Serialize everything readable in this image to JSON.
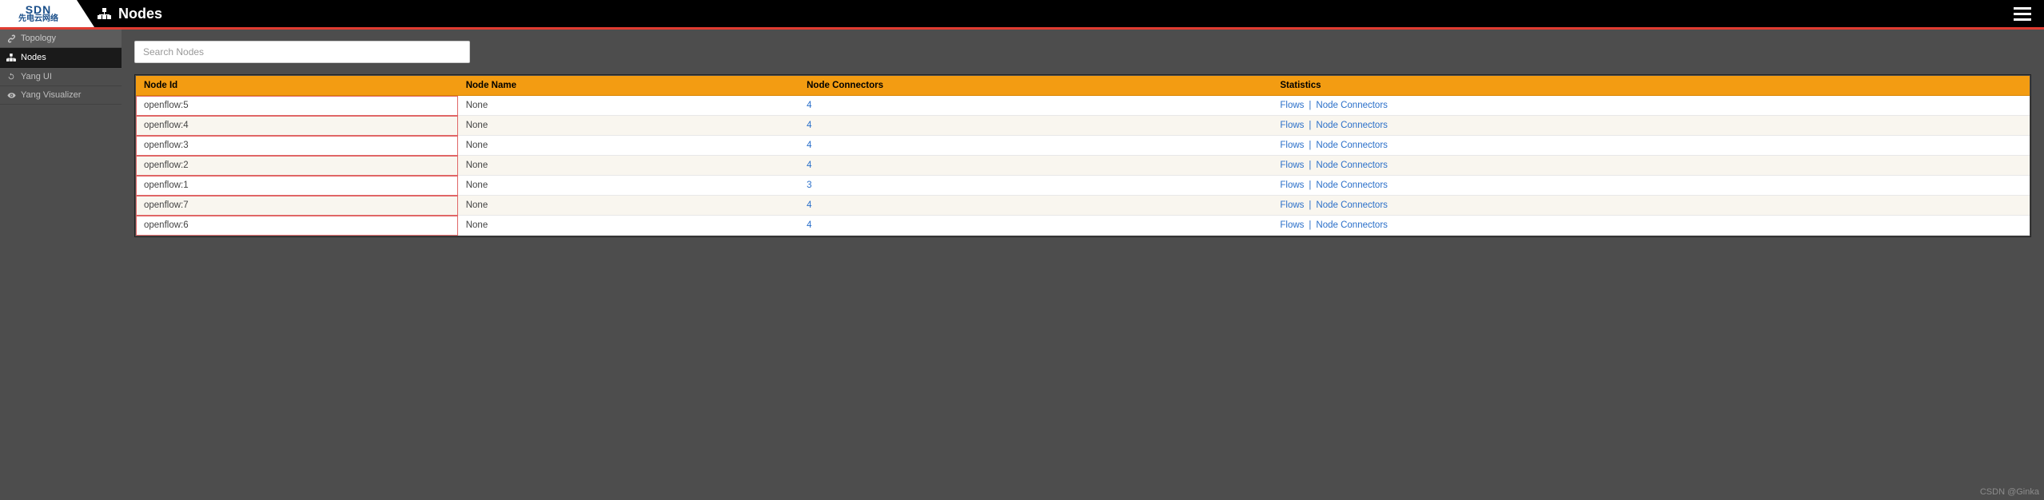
{
  "header": {
    "logo_top": "SDN",
    "logo_bottom": "先电云网络",
    "title": "Nodes"
  },
  "sidebar": {
    "items": [
      {
        "label": "Topology",
        "icon": "link-icon",
        "active": false
      },
      {
        "label": "Nodes",
        "icon": "sitemap-icon",
        "active": true
      },
      {
        "label": "Yang UI",
        "icon": "refresh-icon",
        "active": false
      },
      {
        "label": "Yang Visualizer",
        "icon": "eye-icon",
        "active": false
      }
    ]
  },
  "search": {
    "placeholder": "Search Nodes"
  },
  "table": {
    "headers": {
      "id": "Node Id",
      "name": "Node Name",
      "connectors": "Node Connectors",
      "stats": "Statistics"
    },
    "stat_flows_label": "Flows",
    "stat_nc_label": "Node Connectors",
    "rows": [
      {
        "id": "openflow:5",
        "name": "None",
        "connectors": "4"
      },
      {
        "id": "openflow:4",
        "name": "None",
        "connectors": "4"
      },
      {
        "id": "openflow:3",
        "name": "None",
        "connectors": "4"
      },
      {
        "id": "openflow:2",
        "name": "None",
        "connectors": "4"
      },
      {
        "id": "openflow:1",
        "name": "None",
        "connectors": "3"
      },
      {
        "id": "openflow:7",
        "name": "None",
        "connectors": "4"
      },
      {
        "id": "openflow:6",
        "name": "None",
        "connectors": "4"
      }
    ]
  },
  "watermark": "CSDN @Ginka"
}
